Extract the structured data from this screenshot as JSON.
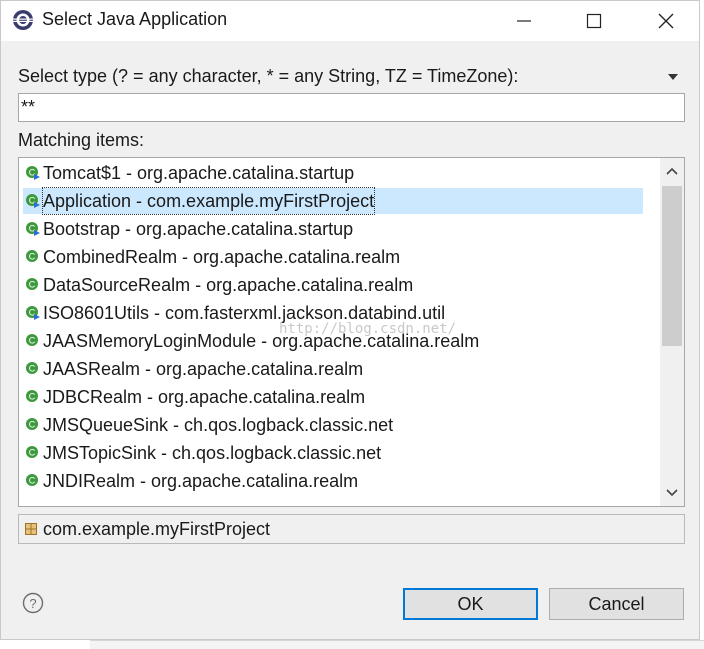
{
  "window": {
    "title": "Select Java Application"
  },
  "filter": {
    "label": "Select type (? = any character, * = any String, TZ = TimeZone):",
    "value": "**"
  },
  "matching": {
    "label": "Matching items:",
    "items": [
      {
        "label": "Tomcat$1 - org.apache.catalina.startup",
        "icon": "java-class-runnable-icon"
      },
      {
        "label": "Application - com.example.myFirstProject",
        "icon": "java-class-runnable-icon",
        "selected": true
      },
      {
        "label": "Bootstrap - org.apache.catalina.startup",
        "icon": "java-class-runnable-icon"
      },
      {
        "label": "CombinedRealm - org.apache.catalina.realm",
        "icon": "java-class-icon"
      },
      {
        "label": "DataSourceRealm - org.apache.catalina.realm",
        "icon": "java-class-icon"
      },
      {
        "label": "ISO8601Utils - com.fasterxml.jackson.databind.util",
        "icon": "java-class-runnable-icon"
      },
      {
        "label": "JAASMemoryLoginModule - org.apache.catalina.realm",
        "icon": "java-class-icon"
      },
      {
        "label": "JAASRealm - org.apache.catalina.realm",
        "icon": "java-class-icon"
      },
      {
        "label": "JDBCRealm - org.apache.catalina.realm",
        "icon": "java-class-icon"
      },
      {
        "label": "JMSQueueSink - ch.qos.logback.classic.net",
        "icon": "java-class-icon"
      },
      {
        "label": "JMSTopicSink - ch.qos.logback.classic.net",
        "icon": "java-class-icon"
      },
      {
        "label": "JNDIRealm - org.apache.catalina.realm",
        "icon": "java-class-icon"
      }
    ],
    "watermark": "http://blog.csdn.net/"
  },
  "status": {
    "package": "com.example.myFirstProject",
    "icon": "package-icon"
  },
  "buttons": {
    "ok": "OK",
    "cancel": "Cancel"
  },
  "colors": {
    "selection": "#cce8ff",
    "default_button_border": "#0078d7",
    "class_icon": "#3c9a3c"
  }
}
